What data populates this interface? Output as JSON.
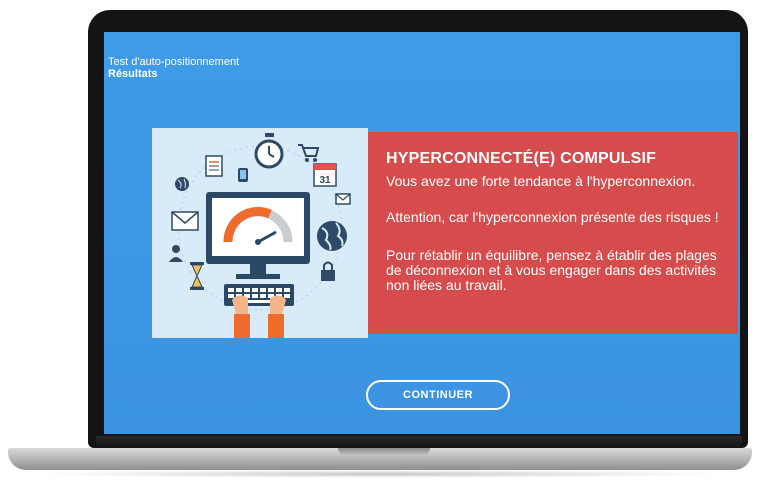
{
  "breadcrumb": {
    "title": "Test d'auto-positionnement",
    "subtitle": "Résultats"
  },
  "result": {
    "heading": "HYPERCONNECTÉ(E) COMPULSIF",
    "paragraph1": "Vous avez une forte tendance à l'hyperconnexion.",
    "paragraph2": "Attention, car l'hyperconnexion présente des risques !",
    "paragraph3": "Pour rétablir un équilibre, pensez à établir des plages de déconnexion et à vous engager dans des activités non liées au travail."
  },
  "illustration": {
    "calendar_day": "31",
    "icons": [
      "stopwatch-icon",
      "shopping-cart-icon",
      "calendar-icon",
      "document-icon",
      "phone-icon",
      "globe-icon",
      "mail-icon",
      "envelope-icon",
      "user-icon",
      "hourglass-icon",
      "lock-icon",
      "monitor-icon",
      "speedometer-icon",
      "keyboard-icon",
      "hands-icon"
    ]
  },
  "actions": {
    "continue_label": "CONTINUER"
  },
  "colors": {
    "screen_bg": "#3d97e6",
    "panel_bg": "#d64b4b",
    "illustration_bg": "#d8ebf8",
    "gauge_orange": "#ef6b2c"
  }
}
